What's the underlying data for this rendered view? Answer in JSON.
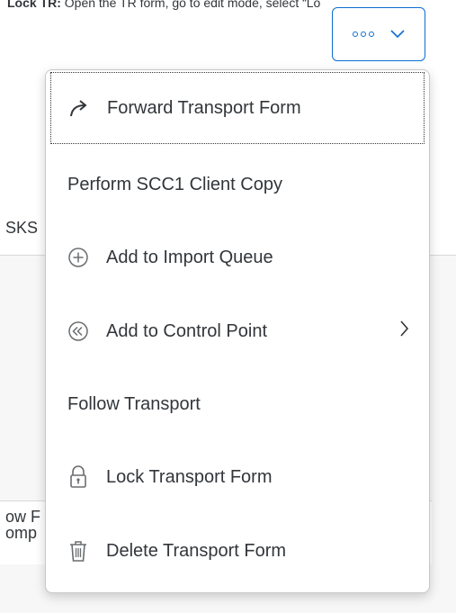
{
  "instruction": {
    "step": "Lock TR:",
    "text": "Open the TR form, go to edit mode, select “Lo"
  },
  "background": {
    "tab_fragment": "SKS",
    "row_line1": "ow F",
    "row_line2": "omp"
  },
  "overflow_button": {
    "icon": "overflow-dots-icon",
    "chevron": "chevron-down-icon"
  },
  "menu": {
    "items": [
      {
        "label": "Forward Transport Form",
        "icon": "forward-arrow-icon",
        "focused": true
      },
      {
        "label": "Perform SCC1 Client Copy",
        "icon": null
      },
      {
        "label": "Add to Import Queue",
        "icon": "add-circle-icon"
      },
      {
        "label": "Add to Control Point",
        "icon": "rewind-circle-icon",
        "submenu": true
      },
      {
        "label": "Follow Transport",
        "icon": null
      },
      {
        "label": "Lock Transport Form",
        "icon": "lock-icon"
      },
      {
        "label": "Delete Transport Form",
        "icon": "trash-icon"
      }
    ]
  },
  "colors": {
    "accent": "#0a6ed1",
    "text": "#32363a",
    "icon": "#6a6d70"
  }
}
